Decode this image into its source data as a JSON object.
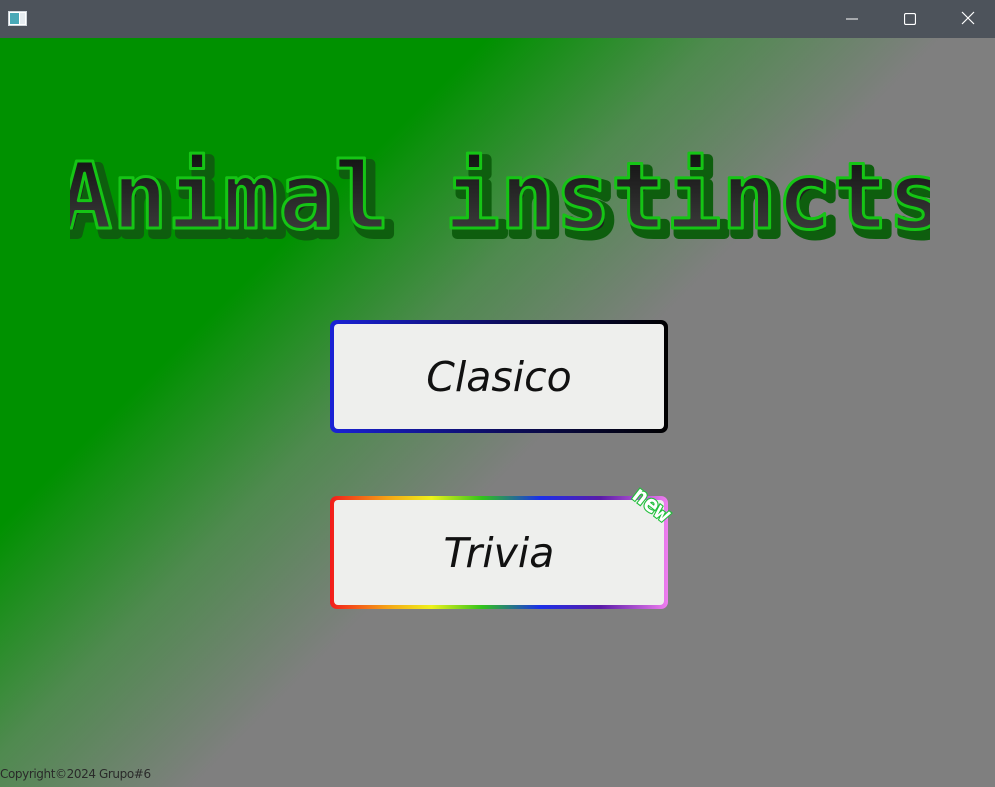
{
  "window": {
    "icon": "app-window-icon",
    "controls": {
      "minimize": "minimize-icon",
      "maximize": "maximize-icon",
      "close": "close-icon"
    }
  },
  "colors": {
    "gradient_green": "#009100",
    "gradient_gray": "#7f7f7f",
    "title_outline": "#11cc11",
    "button_fill": "#eeefed"
  },
  "main": {
    "title": "Animal instincts",
    "buttons": {
      "classic": "Clasico",
      "trivia": "Trivia"
    },
    "new_badge": "new",
    "copyright": "Copyright©2024 Grupo#6"
  }
}
